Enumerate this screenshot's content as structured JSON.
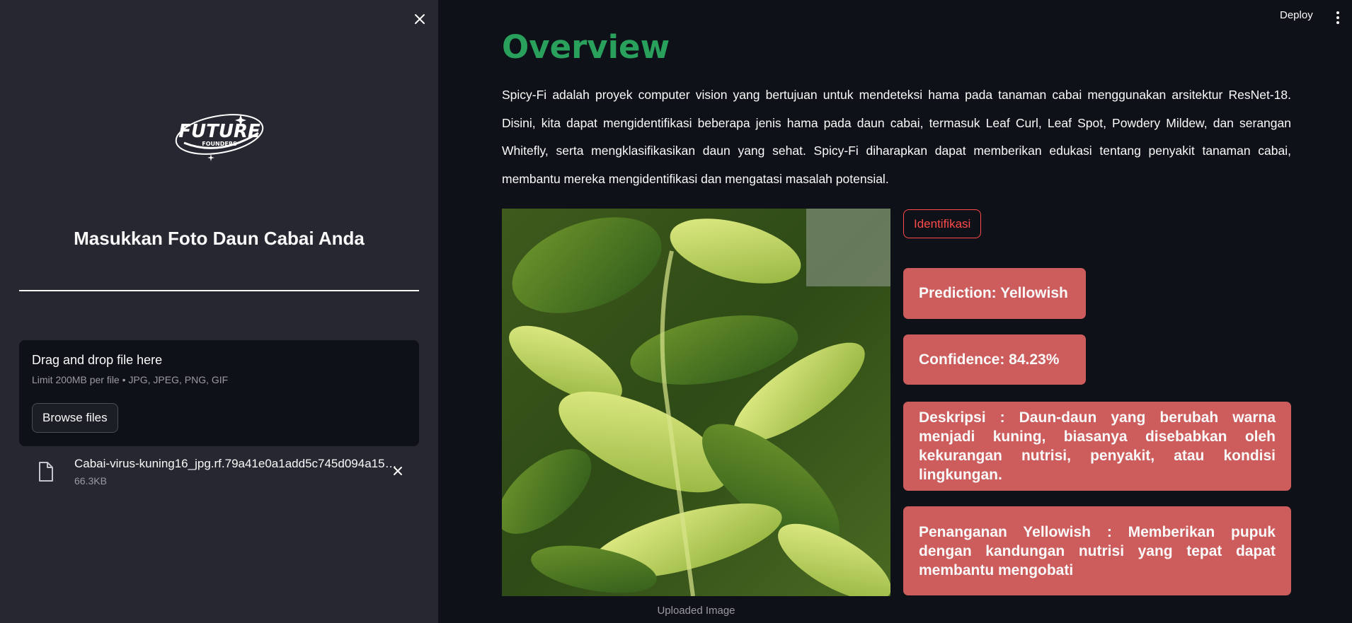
{
  "sidebar": {
    "logo_text": "FUTURE FOUNDERS",
    "heading": "Masukkan Foto Daun Cabai Anda",
    "uploader": {
      "title": "Drag and drop file here",
      "limit": "Limit 200MB per file • JPG, JPEG, PNG, GIF",
      "browse_label": "Browse files"
    },
    "file": {
      "name": "Cabai-virus-kuning16_jpg.rf.79a41e0a1add5c745d094a15…",
      "size": "66.3KB"
    }
  },
  "header": {
    "deploy_label": "Deploy"
  },
  "main": {
    "title": "Overview",
    "description": "Spicy-Fi adalah proyek computer vision yang bertujuan untuk mendeteksi hama pada tanaman cabai menggunakan arsitektur ResNet-18. Disini, kita dapat mengidentifikasi beberapa jenis hama pada daun cabai, termasuk Leaf Curl, Leaf Spot, Powdery Mildew, dan serangan Whitefly, serta mengklasifikasikan daun yang sehat. Spicy-Fi diharapkan dapat memberikan edukasi tentang penyakit tanaman cabai, membantu mereka mengidentifikasi dan mengatasi masalah potensial.",
    "image_caption": "Uploaded Image",
    "identify_label": "Identifikasi",
    "prediction": "Prediction: Yellowish",
    "confidence": "Confidence: 84.23%",
    "description_box": "Deskripsi : Daun-daun yang berubah warna menjadi kuning, biasanya disebabkan oleh kekurangan nutrisi, penyakit, atau kondisi lingkungan.",
    "treatment_box": "Penanganan Yellowish : Memberikan pupuk dengan kandungan nutrisi yang tepat dapat membantu mengobati"
  },
  "colors": {
    "background": "#0e1117",
    "sidebar": "#262730",
    "title_green": "#29a05b",
    "accent_red": "#ff4b4b",
    "result_box": "#cd5c5c"
  }
}
